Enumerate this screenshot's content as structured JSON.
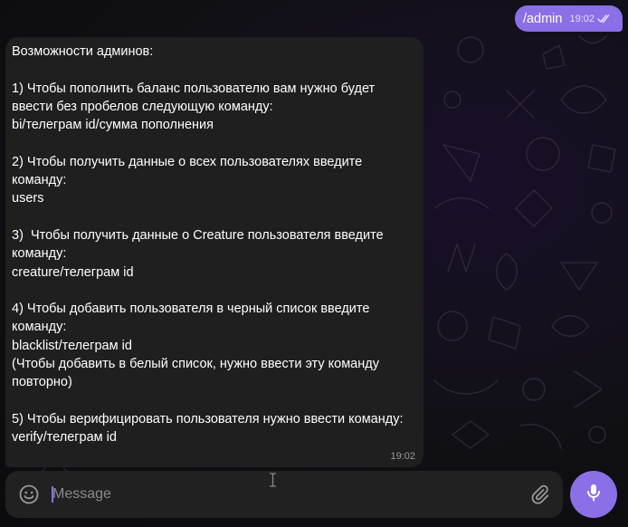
{
  "chat": {
    "outgoing": {
      "text": "/admin",
      "time": "19:02",
      "status_icon": "double-check-icon"
    },
    "incoming": {
      "text": "Возможности админов:\n\n1) Чтобы пополнить баланс пользователю вам нужно будет ввести без пробелов следующую команду:\nbi/телеграм id/сумма пополнения\n\n2) Чтобы получить данные о всех пользователях введите команду:\nusers\n\n3)  Чтобы получить данные о Creature пользователя введите команду:\ncreature/телеграм id\n\n4) Чтобы добавить пользователя в черный список введите команду:\nblacklist/телеграм id\n(Чтобы добавить в белый список, нужно ввести эту команду повторно)\n\n5) Чтобы верифицировать пользователя нужно ввести команду:\nverify/телеграм id",
      "time": "19:02"
    }
  },
  "composer": {
    "placeholder": "Message",
    "value": "",
    "emoji_icon": "emoji-icon",
    "attach_icon": "paperclip-icon",
    "mic_icon": "microphone-icon"
  },
  "colors": {
    "accent": "#8b6fe6",
    "bubble_in": "#1f1f1f",
    "composer_bg": "#212121"
  }
}
